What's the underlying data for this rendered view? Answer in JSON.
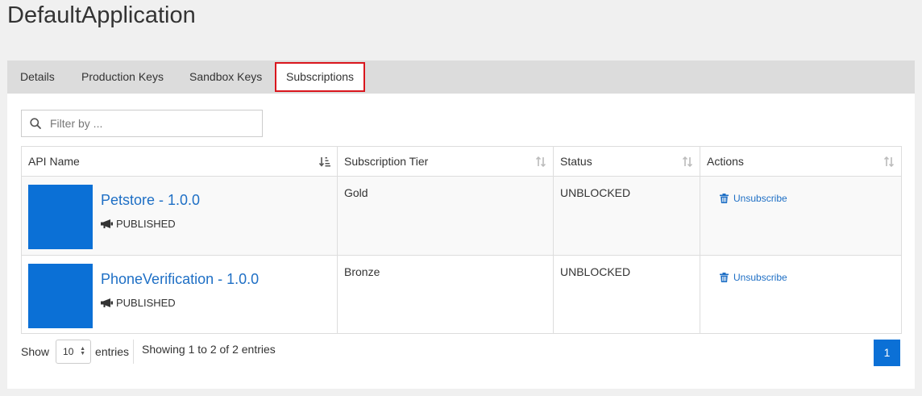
{
  "app": {
    "title": "DefaultApplication"
  },
  "tabs": [
    {
      "label": "Details"
    },
    {
      "label": "Production Keys"
    },
    {
      "label": "Sandbox Keys"
    },
    {
      "label": "Subscriptions"
    }
  ],
  "filter": {
    "placeholder": "Filter by ...",
    "value": ""
  },
  "table": {
    "columns": [
      "API Name",
      "Subscription Tier",
      "Status",
      "Actions"
    ],
    "rows": [
      {
        "api_name": "Petstore - 1.0.0",
        "api_state": "PUBLISHED",
        "tier": "Gold",
        "status": "UNBLOCKED",
        "action": "Unsubscribe"
      },
      {
        "api_name": "PhoneVerification - 1.0.0",
        "api_state": "PUBLISHED",
        "tier": "Bronze",
        "status": "UNBLOCKED",
        "action": "Unsubscribe"
      }
    ]
  },
  "footer": {
    "show_label": "Show",
    "page_length": "10",
    "entries_label": "entries",
    "info": "Showing 1 to 2 of 2 entries",
    "current_page": "1"
  },
  "colors": {
    "accent": "#0b70d6",
    "link": "#1e6fc5",
    "active_tab_border": "#d9161d"
  }
}
